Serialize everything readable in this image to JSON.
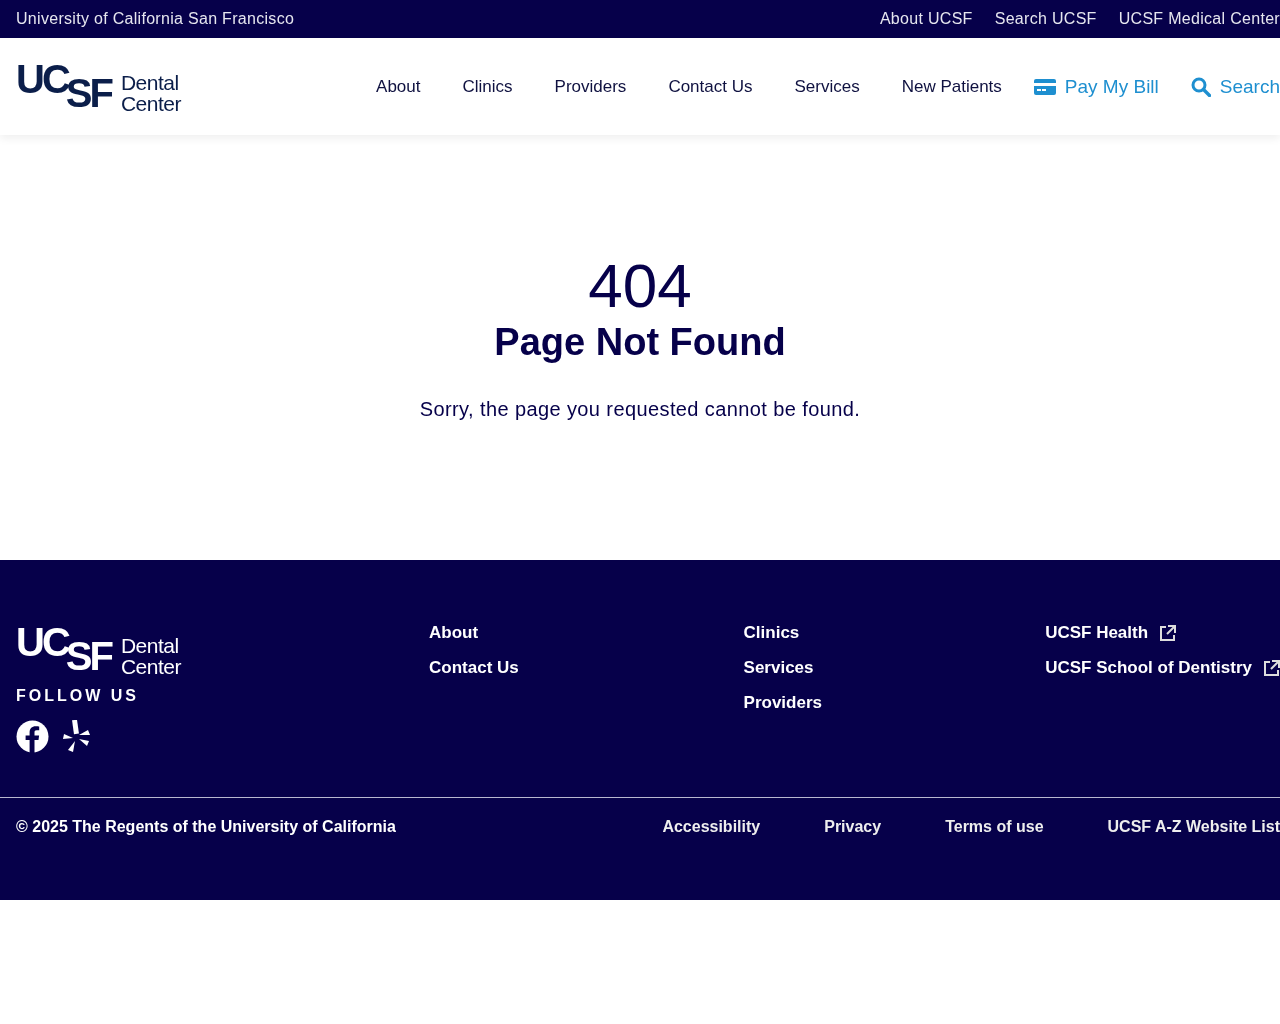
{
  "top_bar": {
    "title": "University of California San Francisco",
    "links": [
      "About UCSF",
      "Search UCSF",
      "UCSF Medical Center"
    ]
  },
  "header": {
    "logo": {
      "mark_1": "UC",
      "mark_2": "SF",
      "line_1": "Dental",
      "line_2": "Center"
    },
    "nav": [
      {
        "label": "About",
        "kind": "plain"
      },
      {
        "label": "Clinics",
        "kind": "plain"
      },
      {
        "label": "Providers",
        "kind": "plain"
      },
      {
        "label": "Contact Us",
        "kind": "plain"
      },
      {
        "label": "Services",
        "kind": "plain"
      },
      {
        "label": "New Patients",
        "kind": "plain"
      },
      {
        "label": "Pay My Bill",
        "kind": "bill"
      },
      {
        "label": "Search",
        "kind": "search"
      }
    ]
  },
  "error": {
    "code": "404",
    "title": "Page Not Found",
    "message": "Sorry, the page you requested cannot be found."
  },
  "footer": {
    "logo": {
      "mark_1": "UC",
      "mark_2": "SF",
      "line_1": "Dental",
      "line_2": "Center"
    },
    "follow_label": "FOLLOW US",
    "columns": [
      [
        {
          "label": "About",
          "external": false
        },
        {
          "label": "Contact Us",
          "external": false
        }
      ],
      [
        {
          "label": "Clinics",
          "external": false
        },
        {
          "label": "Services",
          "external": false
        },
        {
          "label": "Providers",
          "external": false
        }
      ],
      [
        {
          "label": "UCSF Health",
          "external": true
        },
        {
          "label": "UCSF School of Dentistry",
          "external": true
        }
      ]
    ],
    "copyright": "© 2025 The Regents of the University of California",
    "legal_links": [
      "Accessibility",
      "Privacy",
      "Terms of use",
      "UCSF A-Z Website List"
    ]
  }
}
